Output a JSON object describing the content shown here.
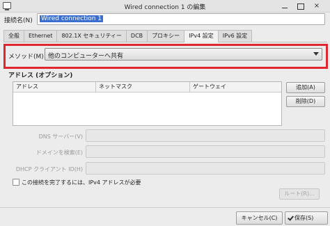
{
  "window": {
    "title": "Wired connection 1 の編集",
    "min_icon": "minimize-icon",
    "max_icon": "maximize-icon",
    "close_icon": "close-icon",
    "close_glyph": "×"
  },
  "connection": {
    "name_label": "接続名(N)",
    "name_value": "Wired connection 1"
  },
  "tabs": [
    {
      "label": "全般"
    },
    {
      "label": "Ethernet"
    },
    {
      "label": "802.1X セキュリティー"
    },
    {
      "label": "DCB"
    },
    {
      "label": "プロキシー"
    },
    {
      "label": "IPv4 設定",
      "active": true
    },
    {
      "label": "IPv6 設定"
    }
  ],
  "method": {
    "label": "メソッド(M)",
    "selected": "他のコンピューターへ共有",
    "highlight_color": "#e0262f"
  },
  "addresses": {
    "title": "アドレス (オプション)",
    "columns": [
      "アドレス",
      "ネットマスク",
      "ゲートウェイ"
    ],
    "rows": [],
    "add_label": "追加(A)",
    "delete_label": "削除(D)"
  },
  "fields": {
    "dns_label": "DNS サーバー(V)",
    "dns_value": "",
    "domain_label": "ドメインを検索(E)",
    "domain_value": "",
    "dhcp_label": "DHCP クライアント ID(H)",
    "dhcp_value": ""
  },
  "require_ipv4": {
    "label": "この接続を完了するには、IPv4 アドレスが必要",
    "checked": false
  },
  "routes_label": "ルート(R)...",
  "buttons": {
    "cancel_label": "キャンセル(C)",
    "save_label": "保存(S)"
  }
}
